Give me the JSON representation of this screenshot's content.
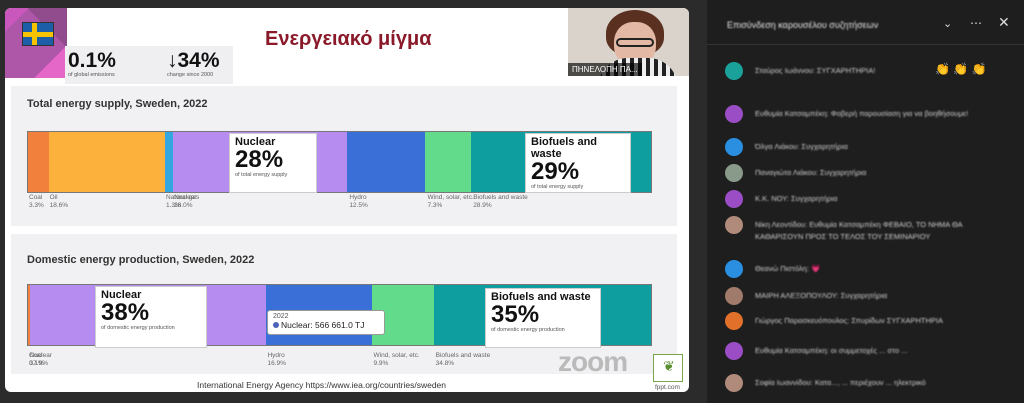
{
  "slide": {
    "title": "Ενεργειακό μίγμα",
    "stats": [
      {
        "value": "0.1%",
        "caption": "of global emissions"
      },
      {
        "value": "↓34%",
        "caption": "change since 2000"
      }
    ],
    "video_participant": "ΠΗΝΕΛΟΠΗ ΠΑ...",
    "source": "International Energy Agency https://www.iea.org/countries/sweden",
    "watermark": "zoom",
    "logo_url": "fppt.com"
  },
  "chart_data": [
    {
      "type": "bar",
      "title": "Total energy supply, Sweden, 2022",
      "segments": [
        {
          "name": "Coal",
          "value": 3.3,
          "label": "3.3%",
          "color": "#f0803c"
        },
        {
          "name": "Oil",
          "value": 18.6,
          "label": "18.6%",
          "color": "#fbb13c"
        },
        {
          "name": "Natural gas",
          "value": 1.3,
          "label": "1.3%",
          "color": "#35a7e0"
        },
        {
          "name": "Nuclear",
          "value": 28.0,
          "label": "28.0%",
          "color": "#b68cf0"
        },
        {
          "name": "Hydro",
          "value": 12.5,
          "label": "12.5%",
          "color": "#3a6fd8"
        },
        {
          "name": "Wind, solar, etc.",
          "value": 7.3,
          "label": "7.3%",
          "color": "#62db8a"
        },
        {
          "name": "Biofuels and waste",
          "value": 28.9,
          "label": "28.9%",
          "color": "#0e9ea0"
        }
      ],
      "callouts": [
        {
          "title": "Nuclear",
          "value": "28%",
          "sub": "of total energy supply"
        },
        {
          "title": "Biofuels and waste",
          "value": "29%",
          "sub": "of total energy supply"
        }
      ]
    },
    {
      "type": "bar",
      "title": "Domestic energy production, Sweden, 2022",
      "segments": [
        {
          "name": "Coal",
          "value": 0.1,
          "label": "0.1%",
          "color": "#f0803c"
        },
        {
          "name": "Nuclear",
          "value": 37.9,
          "label": "37.9%",
          "color": "#b68cf0"
        },
        {
          "name": "Hydro",
          "value": 16.9,
          "label": "16.9%",
          "color": "#3a6fd8"
        },
        {
          "name": "Wind, solar, etc.",
          "value": 9.9,
          "label": "9.9%",
          "color": "#62db8a"
        },
        {
          "name": "Biofuels and waste",
          "value": 34.8,
          "label": "34.8%",
          "color": "#0e9ea0"
        }
      ],
      "callouts": [
        {
          "title": "Nuclear",
          "value": "38%",
          "sub": "of domestic energy production"
        },
        {
          "title": "Biofuels and waste",
          "value": "35%",
          "sub": "of domestic energy production"
        }
      ],
      "tooltip": {
        "year": "2022",
        "text": "Nuclear: 566 661.0 TJ"
      }
    }
  ],
  "chat": {
    "header_title": "Επισύνδεση καρουσέλου συζητήσεων",
    "messages": [
      {
        "text": "Σταύρος Ιωάννου: ΣΥΓΧΑΡΗΤΗΡΙΑ!",
        "color": "#1aa19a",
        "emoji": "👏 👏 👏"
      },
      {
        "text": "Ευθυμία Κατσαμπέκη: Φοβερή παρουσίαση για να βοηθήσουμε!",
        "color": "#9b4dc6"
      },
      {
        "text": "Όλγα Λιάκου: Συγχαρητήρια",
        "color": "#2a8fe0"
      },
      {
        "text": "Παναγιώτα Λιάκου: Συγχαρητήρια",
        "color": "#8a9a8a"
      },
      {
        "text": "Κ.Κ. ΝΟΥ: Συγχαρητήρια",
        "color": "#9b4dc6"
      },
      {
        "text": "Νίκη Λεοντίδου: Ευθυμία Κατσαμπέκη ΦΕΒΑΙΟ, ΤΟ ΝΗΜΑ ΘΑ ΚΑΘΑΡΙΣΟΥΝ ΠΡΟΣ ΤΟ ΤΕΛΟΣ ΤΟΥ ΣΕΜΙΝΑΡΙΟΥ",
        "color": "#b08a7a"
      },
      {
        "text": "Θεανώ Πιστόλη: 💗",
        "color": "#2a8fe0"
      },
      {
        "text": "ΜΑΙΡΗ ΑΛΕΞΟΠΟΥΛΟΥ: Συγχαρητήρια",
        "color": "#a07a6a"
      },
      {
        "text": "Γιώργος Παρασκευόπουλος: Σπυρίδων ΣΥΓΧΑΡΗΤΗΡΙΑ",
        "color": "#e0702a"
      },
      {
        "text": "Ευθυμία Κατσαμπέκη: οι συμμετοχές ... στο ...",
        "color": "#9b4dc6"
      },
      {
        "text": "Σοφία Ιωαννίδου: Κατα..., ... περιέχουν ... ηλεκτρικό",
        "color": "#b08a7a"
      }
    ]
  }
}
